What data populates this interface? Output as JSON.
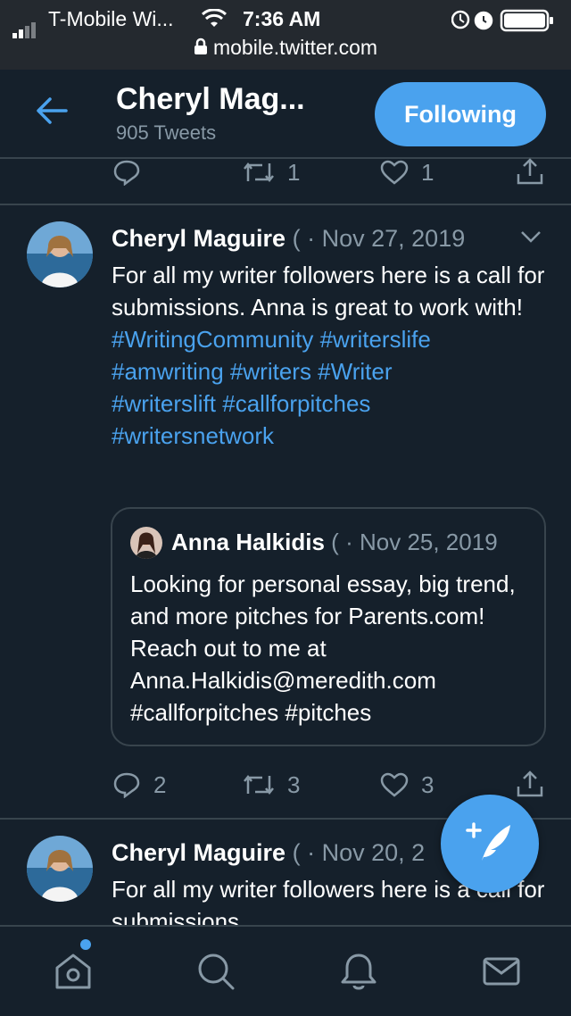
{
  "status_bar": {
    "carrier": "T-Mobile Wi...",
    "time": "7:36 AM",
    "url": "mobile.twitter.com"
  },
  "header": {
    "name": "Cheryl Mag...",
    "tweet_count": "905 Tweets",
    "follow_label": "Following"
  },
  "prev_tweet_actions": {
    "replies": "",
    "retweets": "1",
    "likes": "1"
  },
  "tweets": [
    {
      "author": "Cheryl Maguire",
      "handle_fragment": "(",
      "separator": "·",
      "date": "Nov 27, 2019",
      "text": "For all my writer followers here is a call for submissions. Anna is great to work with!",
      "hashtags_line1": "#WritingCommunity #writerslife",
      "hashtags_line2": "#amwriting #writers #Writer",
      "hashtags_line3": "#writerslift #callforpitches",
      "hashtags_line4": "#writersnetwork",
      "quote": {
        "author": "Anna Halkidis",
        "handle_fragment": "(",
        "separator": "·",
        "date": "Nov 25, 2019",
        "text": "Looking for personal essay, big trend, and more pitches for Parents.com! Reach out to me at Anna.Halkidis@meredith.com #callforpitches #pitches"
      },
      "actions": {
        "replies": "2",
        "retweets": "3",
        "likes": "3"
      }
    },
    {
      "author": "Cheryl Maguire",
      "handle_fragment": "(",
      "separator": "·",
      "date": "Nov 20, 2",
      "text": "For all my writer followers here is a call for submissions."
    }
  ],
  "colors": {
    "background": "#15202b",
    "accent": "#4aa2ee",
    "muted": "#8899a6",
    "border": "#38444d"
  },
  "icons": [
    "back-arrow-icon",
    "reply-icon",
    "retweet-icon",
    "like-icon",
    "share-icon",
    "chevron-down-icon",
    "compose-icon",
    "home-icon",
    "search-icon",
    "notifications-icon",
    "messages-icon"
  ]
}
